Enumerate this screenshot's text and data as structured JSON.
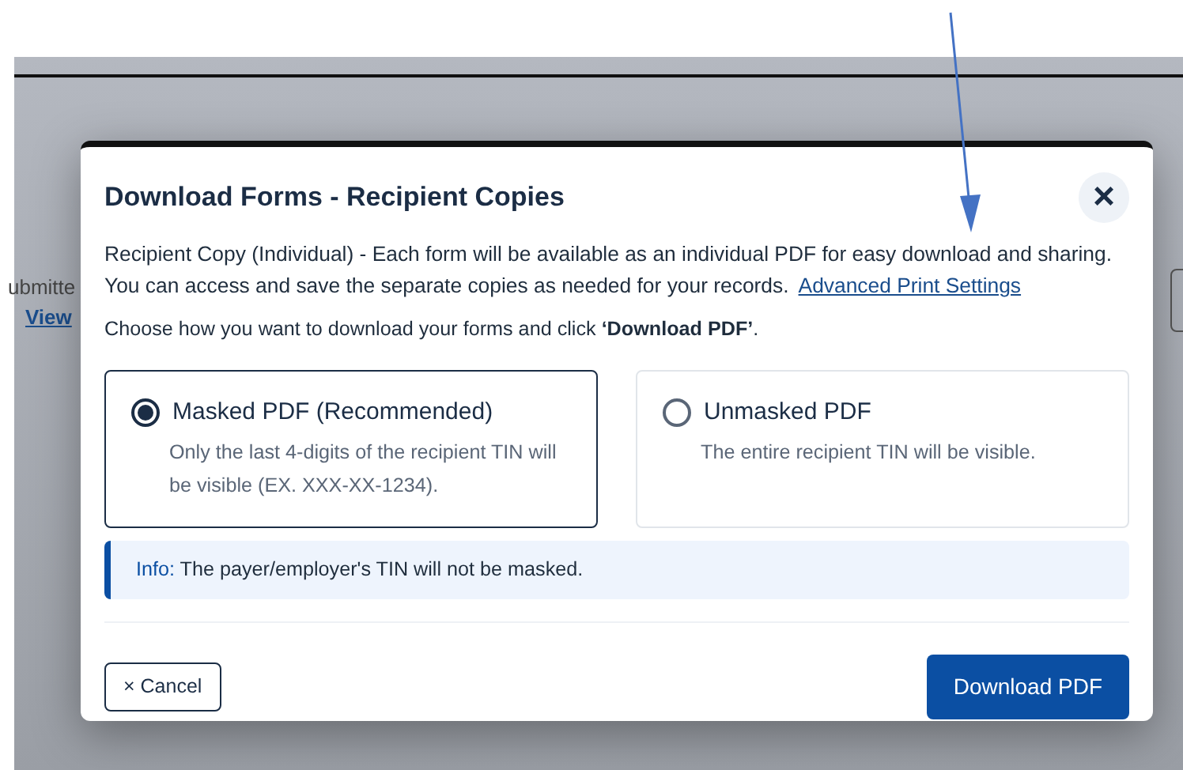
{
  "background": {
    "text": "ubmitte",
    "link": "View"
  },
  "dialog": {
    "title": "Download Forms - Recipient Copies",
    "close": "×",
    "description": "Recipient Copy (Individual) - Each form will be available as an individual PDF for easy download and sharing. You can access and save the separate copies as needed for your records.",
    "settings_link": "Advanced Print Settings",
    "instruction": "Choose how you want to download your forms and click **‘Download PDF’**.",
    "options": [
      {
        "label": "Masked PDF (Recommended)",
        "detail": "Only the last 4-digits of the recipient TIN will be visible (EX. XXX-XX-1234).",
        "selected": true
      },
      {
        "label": "Unmasked PDF",
        "detail": "The entire recipient TIN will be visible.",
        "selected": false
      }
    ],
    "info": {
      "label": "Info:",
      "text": "The payer/employer's TIN will not be masked."
    },
    "buttons": [
      {
        "kind": "secondary",
        "label": "Cancel",
        "icon": "×"
      },
      {
        "kind": "primary",
        "label": "Download PDF"
      }
    ]
  }
}
